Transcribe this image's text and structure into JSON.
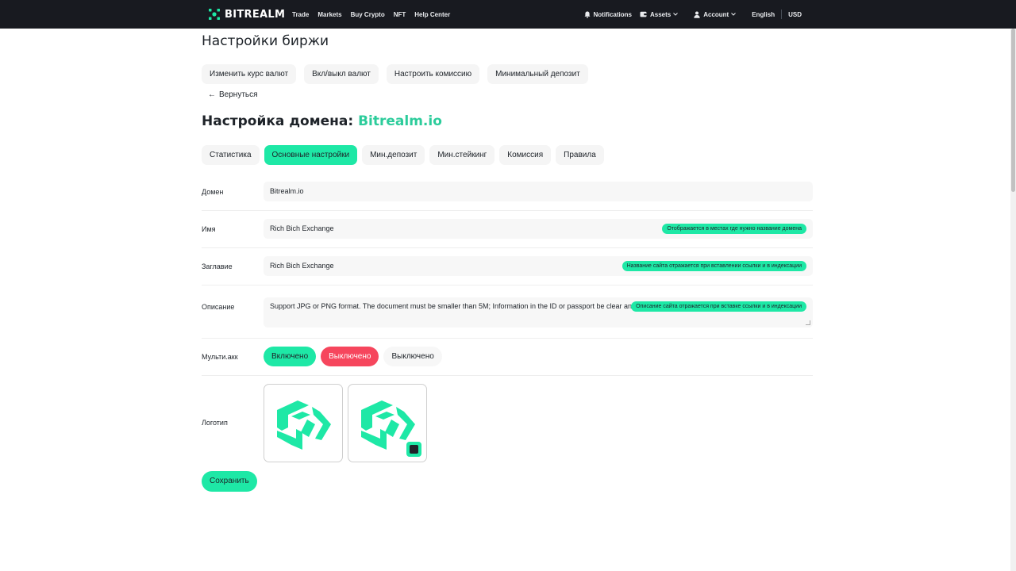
{
  "header": {
    "brand": "BITREALM",
    "nav": [
      "Trade",
      "Markets",
      "Buy Crypto",
      "NFT",
      "Help Center"
    ],
    "notifications": "Notifications",
    "assets": "Assets",
    "account": "Account",
    "language": "English",
    "currency": "USD"
  },
  "page": {
    "title": "Настройки биржи",
    "top_tabs": [
      "Изменить курс валют",
      "Вкл/выкл валют",
      "Настроить комиссию",
      "Минимальный депозит"
    ],
    "back": "Вернуться",
    "domain_title_prefix": "Настройка домена: ",
    "domain_title_name": "Bitrealm.io",
    "sub_tabs": [
      "Статистика",
      "Основные настройки",
      "Мин.депозит",
      "Мин.стейкинг",
      "Комиссия",
      "Правила"
    ]
  },
  "form": {
    "domain": {
      "label": "Домен",
      "value": "Bitrealm.io"
    },
    "name": {
      "label": "Имя",
      "value": "Rich Bich Exchange",
      "hint": "Отображается в местах где нужно название домена"
    },
    "title": {
      "label": "Заглавие",
      "value": "Rich Bich Exchange",
      "hint": "Название сайта отражается при вставлении ссылки и в индексации"
    },
    "description": {
      "label": "Описание",
      "value": "Support JPG or PNG format. The document must be smaller than 5M; Information in the ID or passport be clear and visible without any modification or cover.",
      "hint": "Описание сайта отражается при вставке ссылки и в индексации"
    },
    "multiacc": {
      "label": "Мульти.акк",
      "enabled": "Включено",
      "disabled": "Выключено",
      "status": "Выключено"
    },
    "logo": {
      "label": "Логотип"
    },
    "save": "Сохранить"
  },
  "colors": {
    "accent": "#1ee8a6",
    "danger": "#f6465d",
    "header_bg": "#181a20"
  }
}
